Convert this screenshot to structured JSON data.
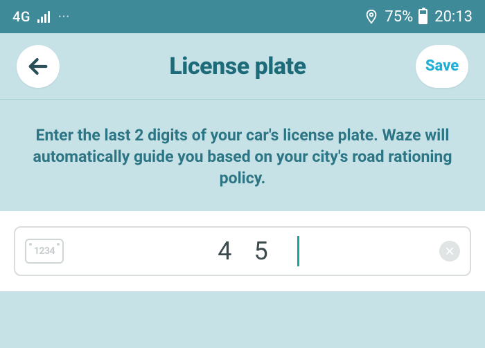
{
  "status": {
    "network": "4G",
    "battery_pct": "75%",
    "time": "20:13"
  },
  "header": {
    "title": "License plate",
    "save_label": "Save"
  },
  "instruction_text": "Enter the last 2 digits of your car's license plate. Waze will automatically guide you based on your city's road rationing policy.",
  "plate_input": {
    "placeholder_icon_text": "1234",
    "value": "45"
  }
}
